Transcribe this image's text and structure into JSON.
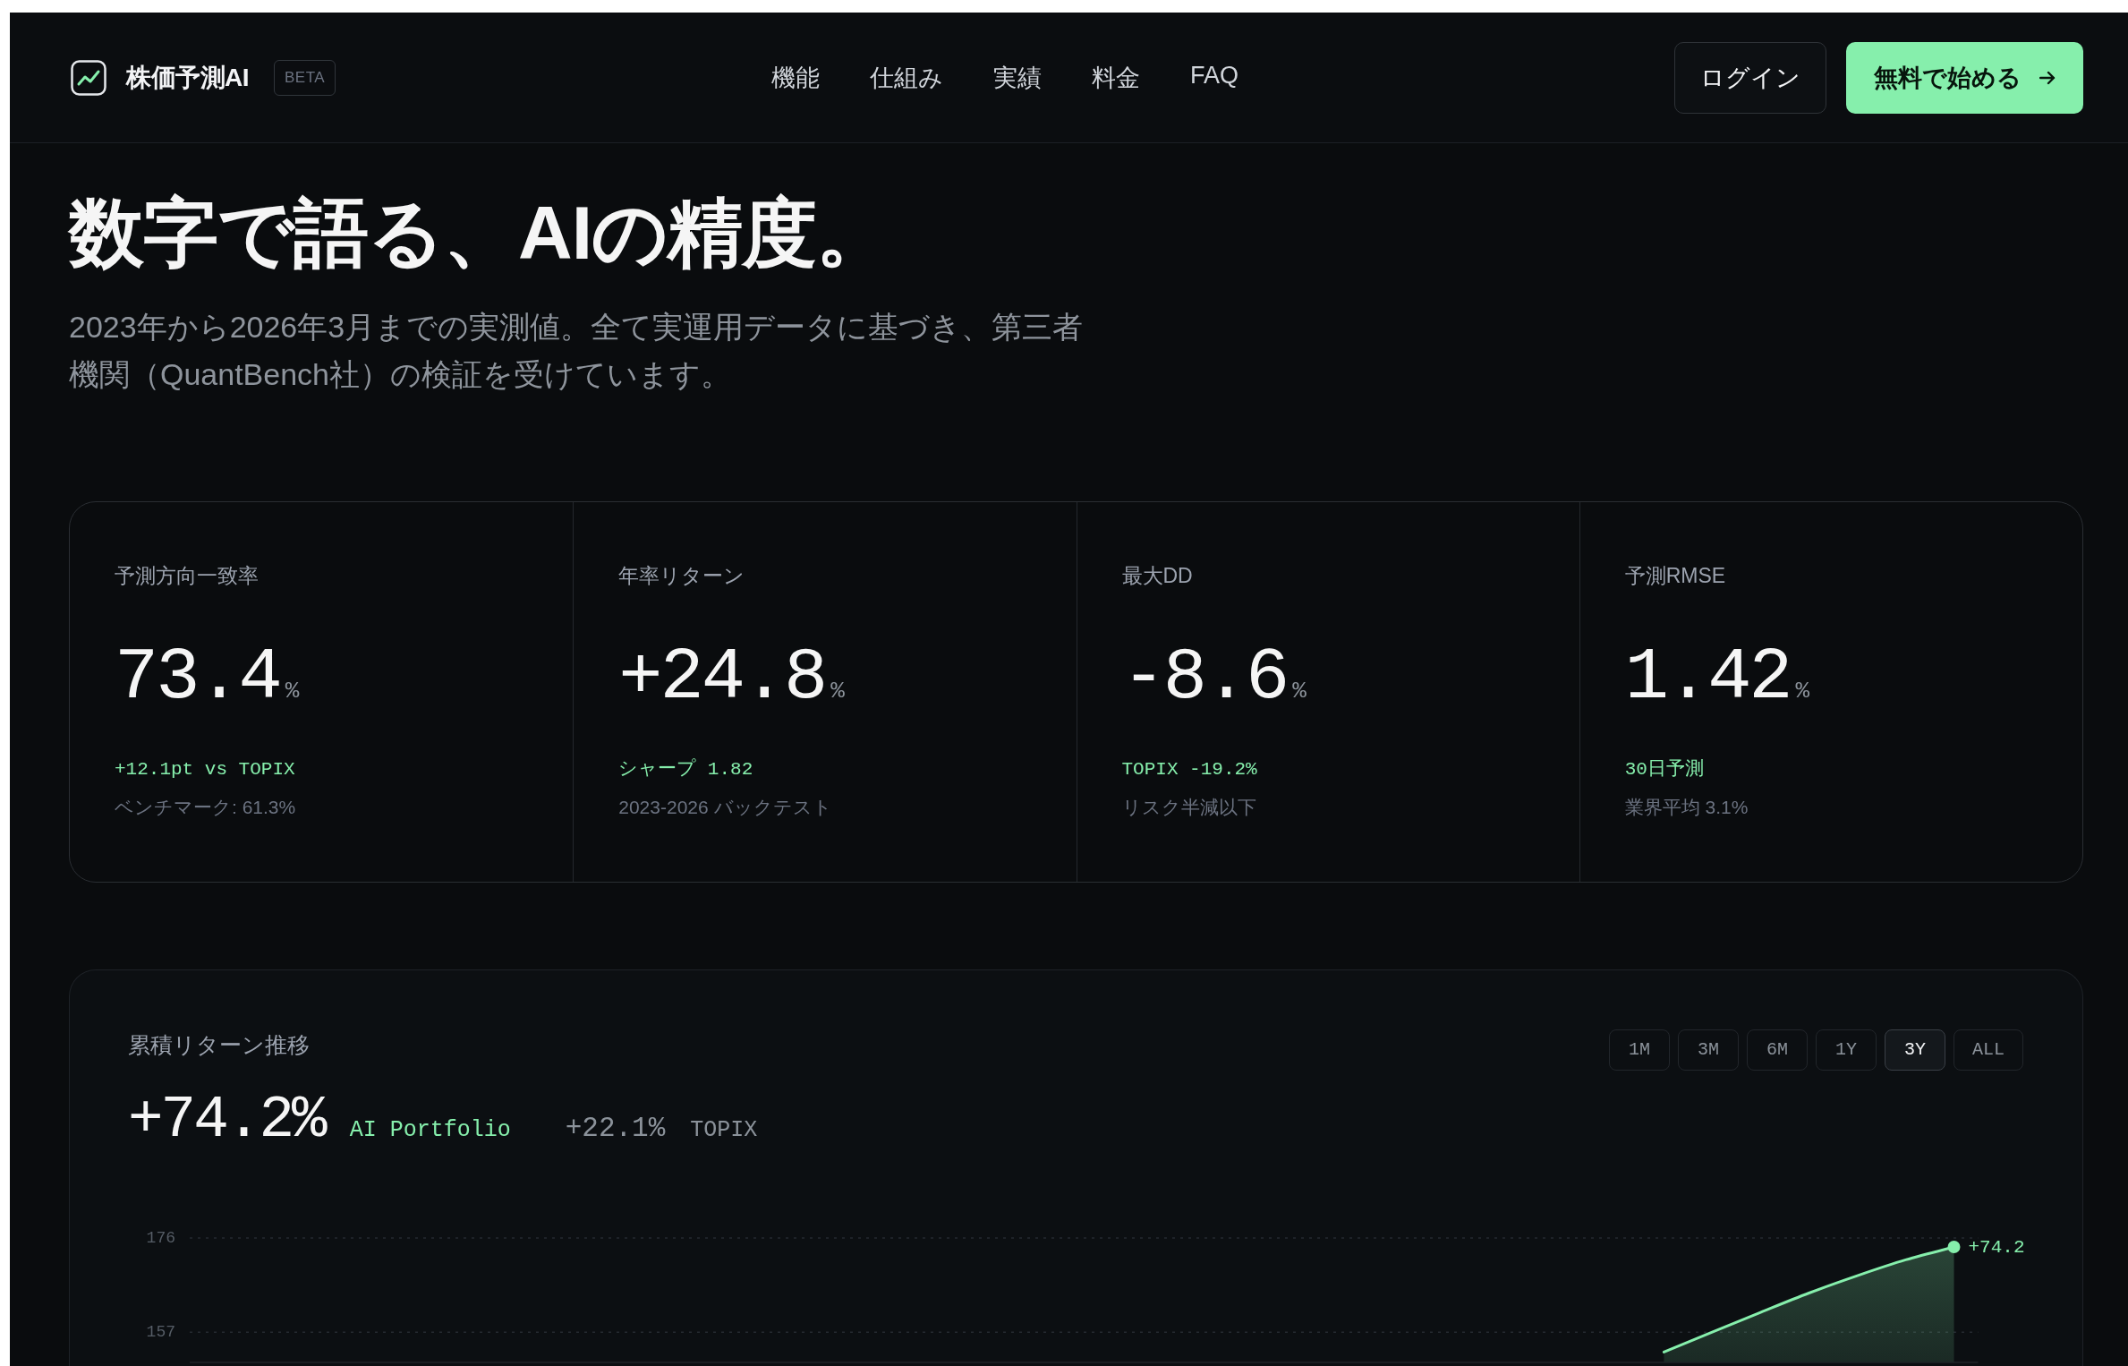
{
  "nav": {
    "brand": "株価予測AI",
    "badge": "BETA",
    "links": [
      {
        "label": "機能"
      },
      {
        "label": "仕組み"
      },
      {
        "label": "実績"
      },
      {
        "label": "料金"
      },
      {
        "label": "FAQ"
      }
    ],
    "login": "ログイン",
    "cta": "無料で始める"
  },
  "hero": {
    "heading": "数字で語る、AIの精度。",
    "lead": "2023年から2026年3月までの実測値。全て実運用データに基づき、第三者機関（QuantBench社）の検証を受けています。"
  },
  "stats": [
    {
      "label": "予測方向一致率",
      "value": "73.4",
      "unit": "%",
      "highlight": "+12.1pt vs TOPIX",
      "note": "ベンチマーク: 61.3%"
    },
    {
      "label": "年率リターン",
      "value": "+24.8",
      "unit": "%",
      "highlight": "シャープ 1.82",
      "note": "2023-2026 バックテスト"
    },
    {
      "label": "最大DD",
      "value": "-8.6",
      "unit": "%",
      "highlight": "TOPIX -19.2%",
      "note": "リスク半減以下"
    },
    {
      "label": "予測RMSE",
      "value": "1.42",
      "unit": "%",
      "highlight": "30日予測",
      "note": "業界平均 3.1%"
    }
  ],
  "chart_panel": {
    "title": "累積リターン推移",
    "ranges": [
      {
        "label": "1M",
        "selected": false
      },
      {
        "label": "3M",
        "selected": false
      },
      {
        "label": "6M",
        "selected": false
      },
      {
        "label": "1Y",
        "selected": false
      },
      {
        "label": "3Y",
        "selected": true
      },
      {
        "label": "ALL",
        "selected": false
      }
    ],
    "summary": {
      "value": "+74.2%",
      "name": "AI Portfolio",
      "compare_value": "+22.1%",
      "compare_name": "TOPIX"
    },
    "chart_data": {
      "type": "area",
      "ylim": [
        150.9,
        176
      ],
      "yticks": [
        176,
        157
      ],
      "series": [
        {
          "color": "#86efac",
          "values": [
            null,
            null,
            null,
            null,
            null,
            null,
            null,
            null,
            null,
            null,
            null,
            null,
            null,
            null,
            null,
            null,
            null,
            null,
            null,
            null,
            null,
            null,
            null,
            null,
            null,
            null,
            null,
            null,
            null,
            null,
            153.0,
            157.0,
            161.0,
            164.9,
            168.4,
            171.6,
            174.2
          ]
        }
      ],
      "annotations": [
        {
          "text": "+74.2"
        }
      ]
    }
  }
}
